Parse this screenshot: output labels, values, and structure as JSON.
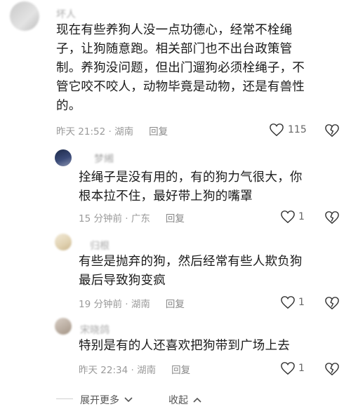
{
  "comments": [
    {
      "name": "坏人",
      "text_lines": [
        "现在有些养狗人没一点功德心，经常不栓绳",
        "子，让狗随意跑。相关部门也不出台政策管",
        "制。养狗没问题，但出门遛狗必须栓绳子，不",
        "管它咬不咬人，动物毕竟是动物，还是有兽性",
        "的。"
      ],
      "time": "昨天 21:52 · 湖南",
      "reply": "回复",
      "likes": "115"
    },
    {
      "name": "梦緗",
      "text_lines": [
        "拴绳子是没有用的，有的狗力气很大，你",
        "根本拉不住，最好带上狗的嘴罩"
      ],
      "time": "15 分钟前 · 广东",
      "reply": "回复",
      "likes": "1"
    },
    {
      "name": "归根",
      "text_lines": [
        "有些是抛弃的狗，然后经常有些人欺负狗",
        "最后导致狗变疯"
      ],
      "time": "19 分钟前 · 湖南",
      "reply": "回复",
      "likes": "1"
    },
    {
      "name": "宋晓鸽",
      "text_lines": [
        "特别是有的人还喜欢把狗带到广场上去"
      ],
      "time": "昨天 22:34 · 湖南",
      "reply": "回复",
      "likes": "1"
    }
  ],
  "footer": {
    "expand": "展开更多",
    "collapse": "收起"
  },
  "colors": {
    "text": "#1a1a1a",
    "meta": "#9a9a9a",
    "name": "#a8a8a8",
    "divider": "#cfcfcf"
  }
}
